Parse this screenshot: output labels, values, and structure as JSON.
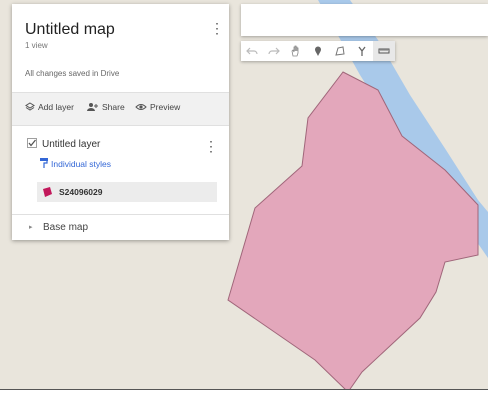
{
  "map": {
    "title": "Untitled map",
    "view_count": "1 view",
    "save_status": "All changes saved in Drive"
  },
  "actions": {
    "add_layer": "Add layer",
    "share": "Share",
    "preview": "Preview"
  },
  "layer": {
    "name": "Untitled layer",
    "checked": true,
    "styles_label": "Individual styles",
    "feature_name": "S24096029",
    "feature_color": "#e3a7bb"
  },
  "base_map": {
    "label": "Base map"
  },
  "toolbar": {
    "tools": [
      "undo-icon",
      "redo-icon",
      "hand-icon",
      "marker-icon",
      "draw-line-icon",
      "directions-icon",
      "ruler-icon"
    ]
  },
  "colors": {
    "map_background": "#e9e5dc",
    "river": "#a9c9ea",
    "polygon_fill": "#e3a7bb",
    "polygon_stroke": "#a0667a"
  }
}
